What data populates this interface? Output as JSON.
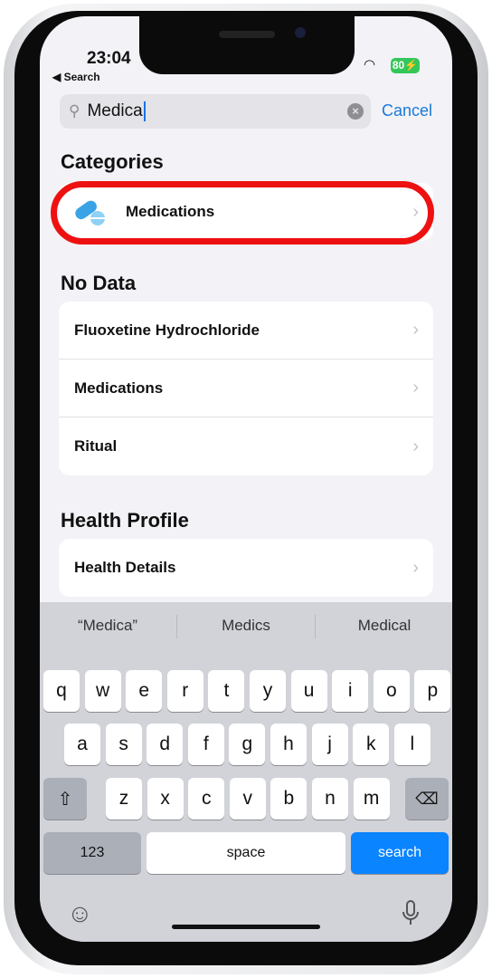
{
  "status": {
    "time": "23:04",
    "back": "◀ Search",
    "battery": "80⚡"
  },
  "search": {
    "value": "Medica",
    "cancel": "Cancel"
  },
  "sections": [
    {
      "title": "Categories",
      "items": [
        "Medications"
      ]
    },
    {
      "title": "No Data",
      "items": [
        "Fluoxetine Hydrochloride",
        "Medications",
        "Ritual"
      ]
    },
    {
      "title": "Health Profile",
      "items": [
        "Health Details"
      ]
    }
  ],
  "highlight_color": "#ee1111",
  "keyboard": {
    "suggestions": [
      "“Medica”",
      "Medics",
      "Medical"
    ],
    "row1": [
      "q",
      "w",
      "e",
      "r",
      "t",
      "y",
      "u",
      "i",
      "o",
      "p"
    ],
    "row2": [
      "a",
      "s",
      "d",
      "f",
      "g",
      "h",
      "j",
      "k",
      "l"
    ],
    "row3": [
      "z",
      "x",
      "c",
      "v",
      "b",
      "n",
      "m"
    ],
    "numbers": "123",
    "space": "space",
    "search": "search"
  }
}
